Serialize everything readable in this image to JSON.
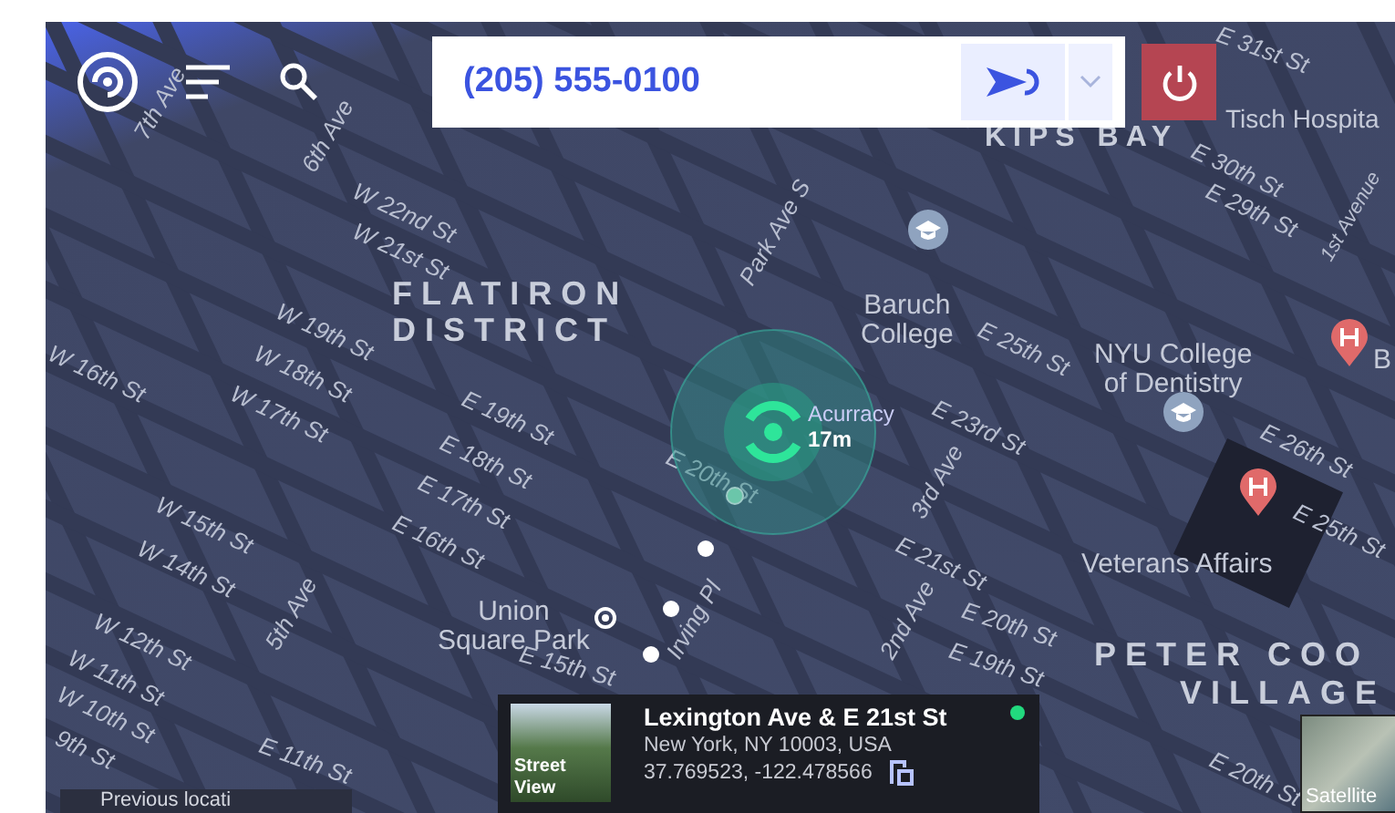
{
  "toolbar": {
    "phone": "(205) 555-0100"
  },
  "map_labels": [
    {
      "text": "7th Ave",
      "kind": "street"
    },
    {
      "text": "6th Ave",
      "kind": "street"
    },
    {
      "text": "W 22nd St",
      "kind": "street"
    },
    {
      "text": "W 21st St",
      "kind": "street"
    },
    {
      "text": "FLATIRON",
      "kind": "district"
    },
    {
      "text": "DISTRICT",
      "kind": "district"
    },
    {
      "text": "Park Ave S",
      "kind": "street"
    },
    {
      "text": "KIPS BAY",
      "kind": "district"
    },
    {
      "text": "E 31st St",
      "kind": "street"
    },
    {
      "text": "Tisch Hospita",
      "kind": "place"
    },
    {
      "text": "E 30th St",
      "kind": "street"
    },
    {
      "text": "E 29th St",
      "kind": "street"
    },
    {
      "text": "1st Avenue",
      "kind": "street"
    },
    {
      "text": "Baruch\nCollege",
      "kind": "place"
    },
    {
      "text": "E 25th St",
      "kind": "street"
    },
    {
      "text": "NYU College\nof Dentistry",
      "kind": "place"
    },
    {
      "text": "B",
      "kind": "place"
    },
    {
      "text": "W 19th St",
      "kind": "street"
    },
    {
      "text": "W 18th St",
      "kind": "street"
    },
    {
      "text": "W 17th St",
      "kind": "street"
    },
    {
      "text": "W 16th St",
      "kind": "street"
    },
    {
      "text": "E 19th St",
      "kind": "street"
    },
    {
      "text": "E 18th St",
      "kind": "street"
    },
    {
      "text": "E 17th St",
      "kind": "street"
    },
    {
      "text": "E 16th St",
      "kind": "street"
    },
    {
      "text": "E 20th St",
      "kind": "street"
    },
    {
      "text": "3rd Ave",
      "kind": "street"
    },
    {
      "text": "E 23rd St",
      "kind": "street"
    },
    {
      "text": "E 21st St",
      "kind": "street"
    },
    {
      "text": "E 26th St",
      "kind": "street"
    },
    {
      "text": "E 25th St",
      "kind": "street"
    },
    {
      "text": "W 15th St",
      "kind": "street"
    },
    {
      "text": "W 14th St",
      "kind": "street"
    },
    {
      "text": "Veterans Affairs",
      "kind": "place"
    },
    {
      "text": "Union\nSquare Park",
      "kind": "place"
    },
    {
      "text": "W 12th St",
      "kind": "street"
    },
    {
      "text": "W 11th St",
      "kind": "street"
    },
    {
      "text": "W 10th St",
      "kind": "street"
    },
    {
      "text": "9th St",
      "kind": "street"
    },
    {
      "text": "5th Ave",
      "kind": "street"
    },
    {
      "text": "E 15th St",
      "kind": "street"
    },
    {
      "text": "Irving Pl",
      "kind": "street"
    },
    {
      "text": "2nd Ave",
      "kind": "street"
    },
    {
      "text": "E 20th St",
      "kind": "street"
    },
    {
      "text": "E 19th St",
      "kind": "street"
    },
    {
      "text": "PETER COO",
      "kind": "district"
    },
    {
      "text": "VILLAGE",
      "kind": "district"
    },
    {
      "text": "E 20th St",
      "kind": "street"
    },
    {
      "text": "E 11th St",
      "kind": "street"
    }
  ],
  "accuracy": {
    "label": "Acurracy",
    "value": "17m"
  },
  "location_card": {
    "photo_label": "Street\nView",
    "title": "Lexington Ave & E 21st St",
    "address": "New York, NY 10003, USA",
    "coordinates": "37.769523, -122.478566",
    "online": true
  },
  "satellite_toggle": {
    "label": "Satellite"
  },
  "previous_location": {
    "label": "Previous locati"
  }
}
